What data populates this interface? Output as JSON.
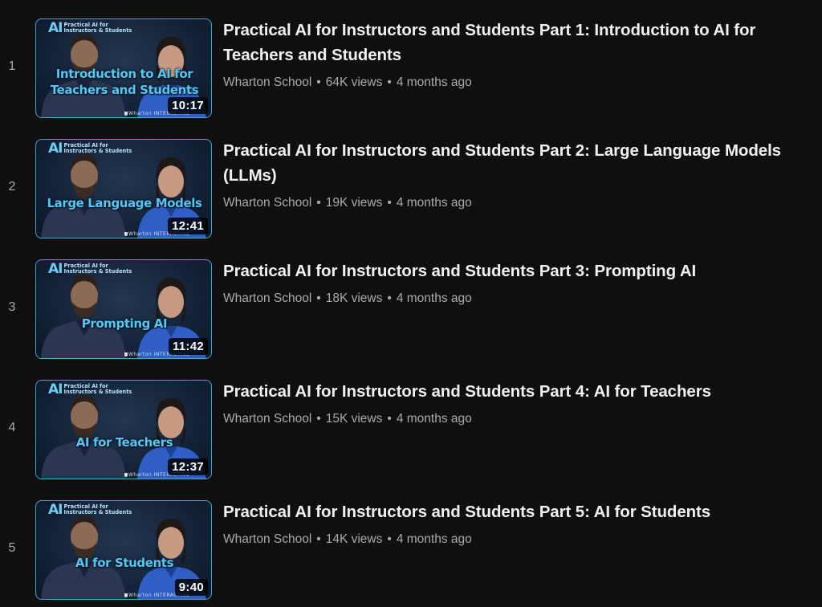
{
  "playlist": {
    "videos": [
      {
        "index": "1",
        "title": "Practical AI for Instructors and Students Part 1: Introduction to AI for Teachers and Students",
        "channel": "Wharton School",
        "views": "64K views",
        "age": "4 months ago",
        "duration": "10:17",
        "thumb_logo": "AI",
        "thumb_brand": "Practical AI for\nInstructors & Students",
        "thumb_text": "Introduction to AI for\nTeachers and Students",
        "thumb_footer": "Wharton INTERACTIVE"
      },
      {
        "index": "2",
        "title": "Practical AI for Instructors and Students Part 2: Large Language Models (LLMs)",
        "channel": "Wharton School",
        "views": "19K views",
        "age": "4 months ago",
        "duration": "12:41",
        "thumb_logo": "AI",
        "thumb_brand": "Practical AI for\nInstructors & Students",
        "thumb_text": "Large Language Models",
        "thumb_footer": "Wharton INTERACTIVE"
      },
      {
        "index": "3",
        "title": "Practical AI for Instructors and Students Part 3: Prompting AI",
        "channel": "Wharton School",
        "views": "18K views",
        "age": "4 months ago",
        "duration": "11:42",
        "thumb_logo": "AI",
        "thumb_brand": "Practical AI for\nInstructors & Students",
        "thumb_text": "Prompting AI",
        "thumb_footer": "Wharton INTERACTIVE"
      },
      {
        "index": "4",
        "title": "Practical AI for Instructors and Students Part 4: AI for Teachers",
        "channel": "Wharton School",
        "views": "15K views",
        "age": "4 months ago",
        "duration": "12:37",
        "thumb_logo": "AI",
        "thumb_brand": "Practical AI for\nInstructors & Students",
        "thumb_text": "AI for Teachers",
        "thumb_footer": "Wharton INTERACTIVE"
      },
      {
        "index": "5",
        "title": "Practical AI for Instructors and Students Part 5: AI for Students",
        "channel": "Wharton School",
        "views": "14K views",
        "age": "4 months ago",
        "duration": "9:40",
        "thumb_logo": "AI",
        "thumb_brand": "Practical AI for\nInstructors & Students",
        "thumb_text": "AI for Students",
        "thumb_footer": "Wharton INTERACTIVE"
      }
    ],
    "separator": "•",
    "colors": {
      "background": "#0f0f0f",
      "title": "#f1f1f1",
      "secondary": "#aaaaaa",
      "thumb_accent": "#52c9f4"
    }
  }
}
